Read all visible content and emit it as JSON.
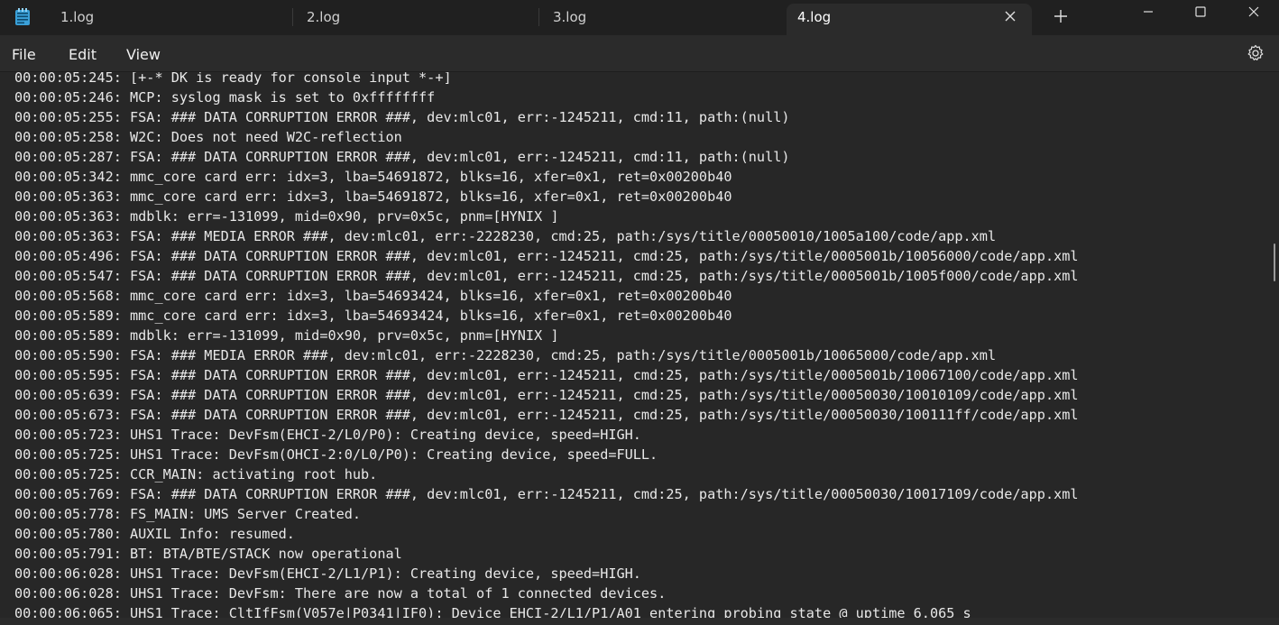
{
  "tabs": [
    {
      "label": "1.log",
      "active": false
    },
    {
      "label": "2.log",
      "active": false
    },
    {
      "label": "3.log",
      "active": false
    },
    {
      "label": "4.log",
      "active": true
    }
  ],
  "icons": {
    "app": "notepad-icon",
    "close_tab": "close-icon",
    "new_tab": "plus-icon",
    "minimize": "minimize-icon",
    "maximize": "maximize-icon",
    "close_window": "close-icon",
    "settings": "gear-icon"
  },
  "menu": {
    "file": "File",
    "edit": "Edit",
    "view": "View"
  },
  "editor": {
    "lines": [
      "00:00:05:245: [+-* DK is ready for console input *-+]",
      "00:00:05:246: MCP: syslog mask is set to 0xffffffff",
      "00:00:05:255: FSA: ### DATA CORRUPTION ERROR ###, dev:mlc01, err:-1245211, cmd:11, path:(null)",
      "00:00:05:258: W2C: Does not need W2C-reflection",
      "00:00:05:287: FSA: ### DATA CORRUPTION ERROR ###, dev:mlc01, err:-1245211, cmd:11, path:(null)",
      "00:00:05:342: mmc_core card err: idx=3, lba=54691872, blks=16, xfer=0x1, ret=0x00200b40",
      "00:00:05:363: mmc_core card err: idx=3, lba=54691872, blks=16, xfer=0x1, ret=0x00200b40",
      "00:00:05:363: mdblk: err=-131099, mid=0x90, prv=0x5c, pnm=[HYNIX ]",
      "00:00:05:363: FSA: ### MEDIA ERROR ###, dev:mlc01, err:-2228230, cmd:25, path:/sys/title/00050010/1005a100/code/app.xml",
      "00:00:05:496: FSA: ### DATA CORRUPTION ERROR ###, dev:mlc01, err:-1245211, cmd:25, path:/sys/title/0005001b/10056000/code/app.xml",
      "00:00:05:547: FSA: ### DATA CORRUPTION ERROR ###, dev:mlc01, err:-1245211, cmd:25, path:/sys/title/0005001b/1005f000/code/app.xml",
      "00:00:05:568: mmc_core card err: idx=3, lba=54693424, blks=16, xfer=0x1, ret=0x00200b40",
      "00:00:05:589: mmc_core card err: idx=3, lba=54693424, blks=16, xfer=0x1, ret=0x00200b40",
      "00:00:05:589: mdblk: err=-131099, mid=0x90, prv=0x5c, pnm=[HYNIX ]",
      "00:00:05:590: FSA: ### MEDIA ERROR ###, dev:mlc01, err:-2228230, cmd:25, path:/sys/title/0005001b/10065000/code/app.xml",
      "00:00:05:595: FSA: ### DATA CORRUPTION ERROR ###, dev:mlc01, err:-1245211, cmd:25, path:/sys/title/0005001b/10067100/code/app.xml",
      "00:00:05:639: FSA: ### DATA CORRUPTION ERROR ###, dev:mlc01, err:-1245211, cmd:25, path:/sys/title/00050030/10010109/code/app.xml",
      "00:00:05:673: FSA: ### DATA CORRUPTION ERROR ###, dev:mlc01, err:-1245211, cmd:25, path:/sys/title/00050030/100111ff/code/app.xml",
      "00:00:05:723: UHS1 Trace: DevFsm(EHCI-2/L0/P0): Creating device, speed=HIGH.",
      "00:00:05:725: UHS1 Trace: DevFsm(OHCI-2:0/L0/P0): Creating device, speed=FULL.",
      "00:00:05:725: CCR_MAIN: activating root hub.",
      "00:00:05:769: FSA: ### DATA CORRUPTION ERROR ###, dev:mlc01, err:-1245211, cmd:25, path:/sys/title/00050030/10017109/code/app.xml",
      "00:00:05:778: FS_MAIN: UMS Server Created.",
      "00:00:05:780: AUXIL Info: resumed.",
      "00:00:05:791: BT: BTA/BTE/STACK now operational",
      "00:00:06:028: UHS1 Trace: DevFsm(EHCI-2/L1/P1): Creating device, speed=HIGH.",
      "00:00:06:028: UHS1 Trace: DevFsm: There are now a total of 1 connected devices.",
      "00:00:06:065: UHS1 Trace: CltIfFsm(V057e|P0341|IF0): Device EHCI-2/L1/P1/A01 entering probing state @ uptime 6.065 s"
    ]
  }
}
